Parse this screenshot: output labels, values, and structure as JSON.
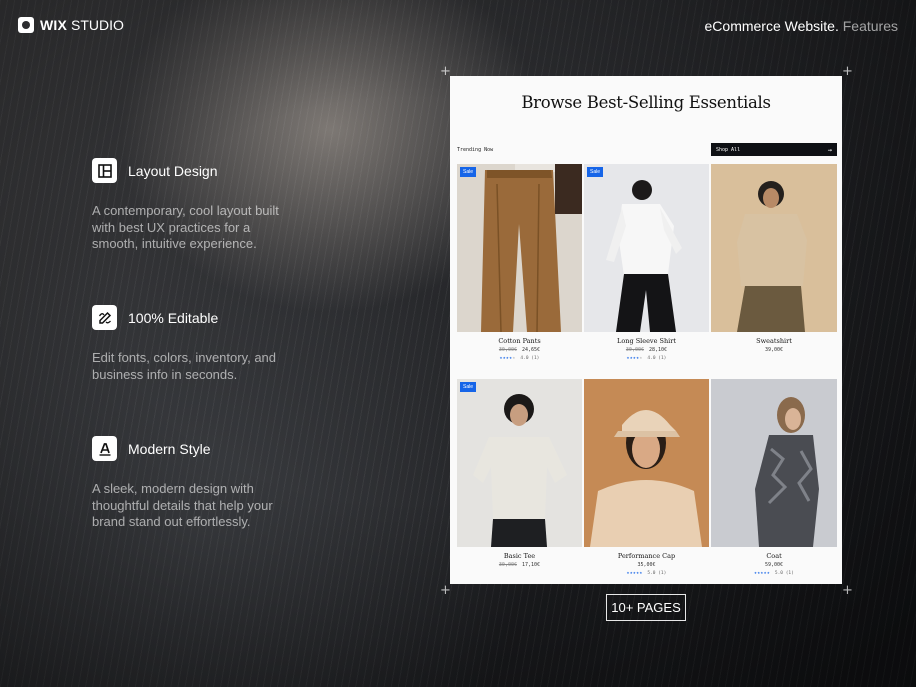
{
  "brand": {
    "wix": "WIX",
    "studio": "STUDIO"
  },
  "header": {
    "title": "eCommerce Website.",
    "subtitle": "Features"
  },
  "features": [
    {
      "title": "Layout Design",
      "description": "A contemporary, cool layout built with best UX practices for a smooth, intuitive experience.",
      "icon": "layout-icon"
    },
    {
      "title": "100% Editable",
      "description": "Edit fonts, colors, inventory, and business info in seconds.",
      "icon": "edit-icon"
    },
    {
      "title": "Modern Style",
      "description": "A sleek, modern design with thoughtful details that help your brand stand out effortlessly.",
      "icon": "font-style-icon"
    }
  ],
  "store": {
    "title": "Browse Best-Selling Essentials",
    "trending": "Trending Now",
    "shop_all": "Shop All",
    "shop_all_arrow": "→",
    "products": [
      {
        "name": "Cotton Pants",
        "sale": "Sale",
        "old_price": "30,00€",
        "price": "24,65€",
        "rating": 4,
        "rating_text": "4.0 (1)"
      },
      {
        "name": "Long Sleeve Shirt",
        "sale": "Sale",
        "old_price": "30,00€",
        "price": "28,10€",
        "rating": 4,
        "rating_text": "4.0 (1)"
      },
      {
        "name": "Sweatshirt",
        "sale": "",
        "old_price": "",
        "price": "39,00€",
        "rating": 0,
        "rating_text": ""
      },
      {
        "name": "Basic Tee",
        "sale": "Sale",
        "old_price": "30,00€",
        "price": "17,10€",
        "rating": 0,
        "rating_text": ""
      },
      {
        "name": "Performance Cap",
        "sale": "",
        "old_price": "",
        "price": "35,00€",
        "rating": 5,
        "rating_text": "5.0 (1)"
      },
      {
        "name": "Coat",
        "sale": "",
        "old_price": "",
        "price": "59,00€",
        "rating": 5,
        "rating_text": "5.0 (1)"
      }
    ]
  },
  "badge": {
    "pages": "10+ PAGES"
  },
  "colors": {
    "accent": "#1665e8",
    "card": "#fafafa",
    "dark_button": "#0e1014"
  }
}
